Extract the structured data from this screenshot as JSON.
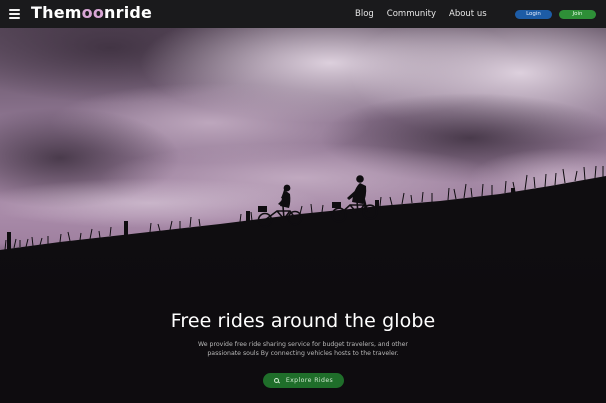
{
  "header": {
    "menu_icon": "hamburger-menu-icon",
    "logo": {
      "prefix": "Them",
      "moon": "oo",
      "suffix": "nride"
    },
    "nav": [
      {
        "label": "Blog"
      },
      {
        "label": "Community"
      },
      {
        "label": "About us"
      }
    ],
    "login_label": "Login",
    "join_label": "Join"
  },
  "hero": {
    "title": "Free rides around the globe",
    "description": "We provide free ride sharing service for budget travelers, and other passionate souls By connecting vehicles hosts to the traveler.",
    "cta_label": "Explore Rides",
    "cta_icon": "search-icon"
  },
  "colors": {
    "navbar": "#1a1a1c",
    "login_button": "#1d5ca6",
    "join_button": "#2e8f37",
    "cta_button": "#1f6e2a",
    "logo_accent": "#d9a7d6",
    "sky_tint": "#9b7f9e"
  }
}
